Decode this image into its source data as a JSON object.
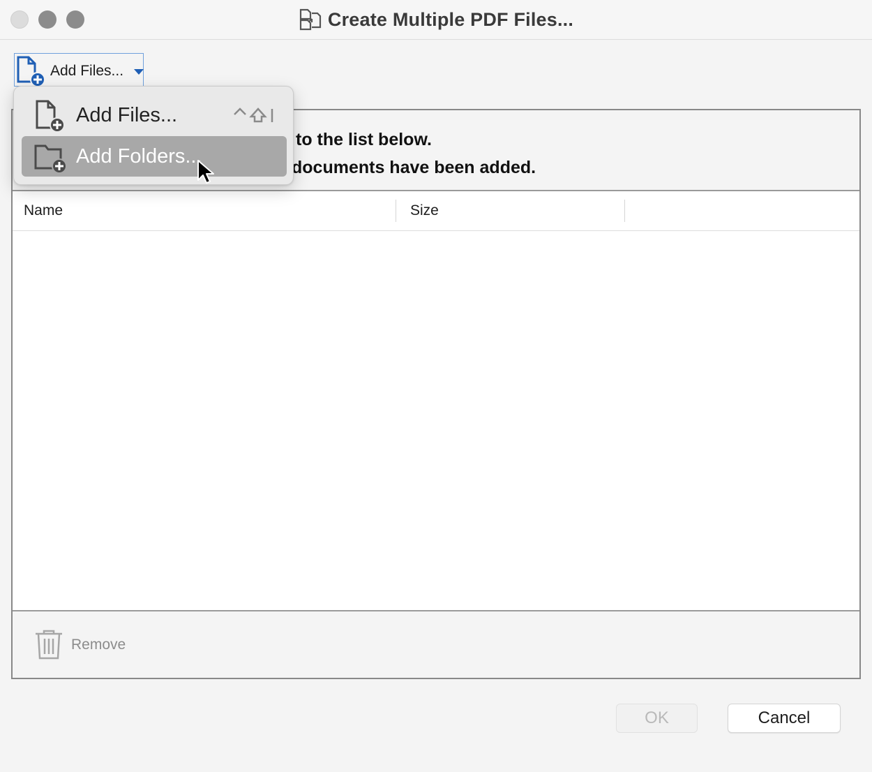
{
  "window": {
    "title": "Create Multiple PDF Files..."
  },
  "toolbar": {
    "add_button_label": "Add Files..."
  },
  "instructions": {
    "line1": "to the list below.",
    "line2": "documents have been added."
  },
  "table": {
    "columns": [
      "Name",
      "Size"
    ],
    "rows": []
  },
  "footer": {
    "remove_label": "Remove"
  },
  "actions": {
    "ok_label": "OK",
    "cancel_label": "Cancel"
  },
  "menu": {
    "items": [
      {
        "label": "Add Files...",
        "icon": "add-file-icon",
        "shortcut": "⌃⇧I"
      },
      {
        "label": "Add Folders...",
        "icon": "add-folder-icon",
        "highlighted": true
      }
    ]
  },
  "colors": {
    "accent": "#1f5fb5",
    "highlight": "#a8a8a8"
  }
}
